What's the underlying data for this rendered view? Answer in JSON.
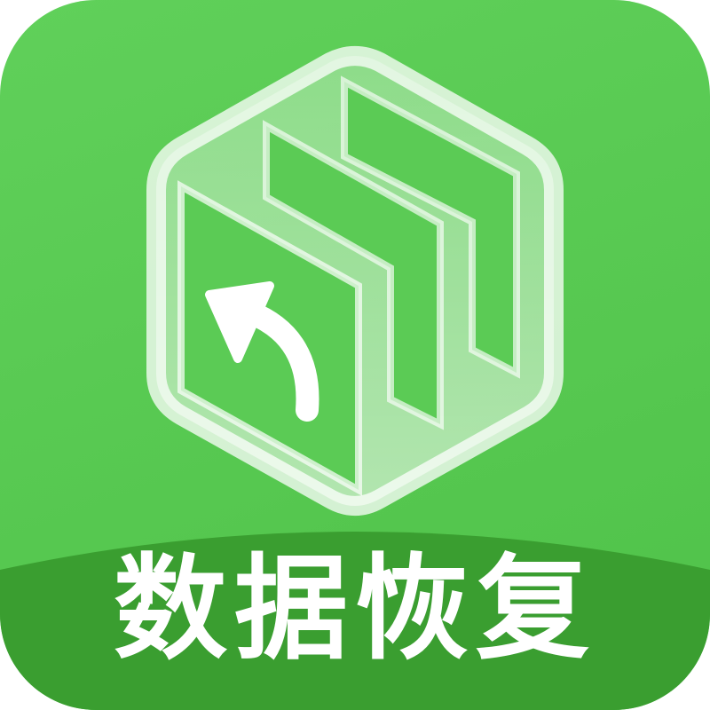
{
  "app_icon": {
    "label": "数据恢复",
    "logo_icon": "hexagon-folder-restore-icon",
    "colors": {
      "tile_green": "#5bcb55",
      "band_green": "#3a9e30",
      "emblem_white": "#ffffff",
      "label_text": "#ffffff"
    }
  }
}
